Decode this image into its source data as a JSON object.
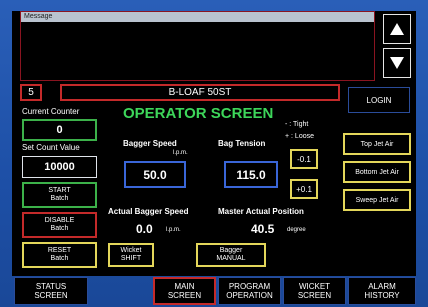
{
  "message_panel": {
    "title": "Message"
  },
  "nav": {
    "up_icon": "triangle-up-icon",
    "down_icon": "triangle-down-icon"
  },
  "header": {
    "screen_number": "5",
    "machine_name": "B-LOAF 50ST",
    "login_label": "LOGIN"
  },
  "title": "OPERATOR SCREEN",
  "counters": {
    "current_label": "Current Counter",
    "current_value": "0",
    "set_label": "Set Count Value",
    "set_value": "10000"
  },
  "batch_buttons": {
    "start": [
      "START",
      "Batch"
    ],
    "disable": [
      "DISABLE",
      "Batch"
    ],
    "reset": [
      "RESET",
      "Batch"
    ]
  },
  "bagger_speed": {
    "label": "Bagger Speed",
    "unit": "l.p.m.",
    "value": "50.0"
  },
  "bag_tension": {
    "label": "Bag Tension",
    "value": "115.0",
    "tight_hint": "- : Tight",
    "loose_hint": "+ : Loose",
    "minus_label": "-0.1",
    "plus_label": "+0.1"
  },
  "jet_air": {
    "top": "Top Jet Air",
    "bottom": "Bottom Jet Air",
    "sweep": "Sweep Jet Air"
  },
  "actual_bagger_speed": {
    "label": "Actual Bagger Speed",
    "value": "0.0",
    "unit": "l.p.m."
  },
  "master_position": {
    "label": "Master Actual Position",
    "value": "40.5",
    "unit": "degree"
  },
  "mode_buttons": {
    "wicket_shift": [
      "Wicket",
      "SHIFT"
    ],
    "bagger_manual": [
      "Bagger",
      "MANUAL"
    ]
  },
  "bottom_nav": [
    [
      "STATUS",
      "SCREEN"
    ],
    [
      "MAIN",
      "SCREEN"
    ],
    [
      "PROGRAM",
      "OPERATION"
    ],
    [
      "WICKET",
      "SCREEN"
    ],
    [
      "ALARM",
      "HISTORY"
    ]
  ],
  "colors": {
    "title_green": "#3dd65a",
    "active_red": "#c42a2a",
    "accent_yellow": "#e3d65a",
    "background_blue": "#1d4fa6"
  }
}
